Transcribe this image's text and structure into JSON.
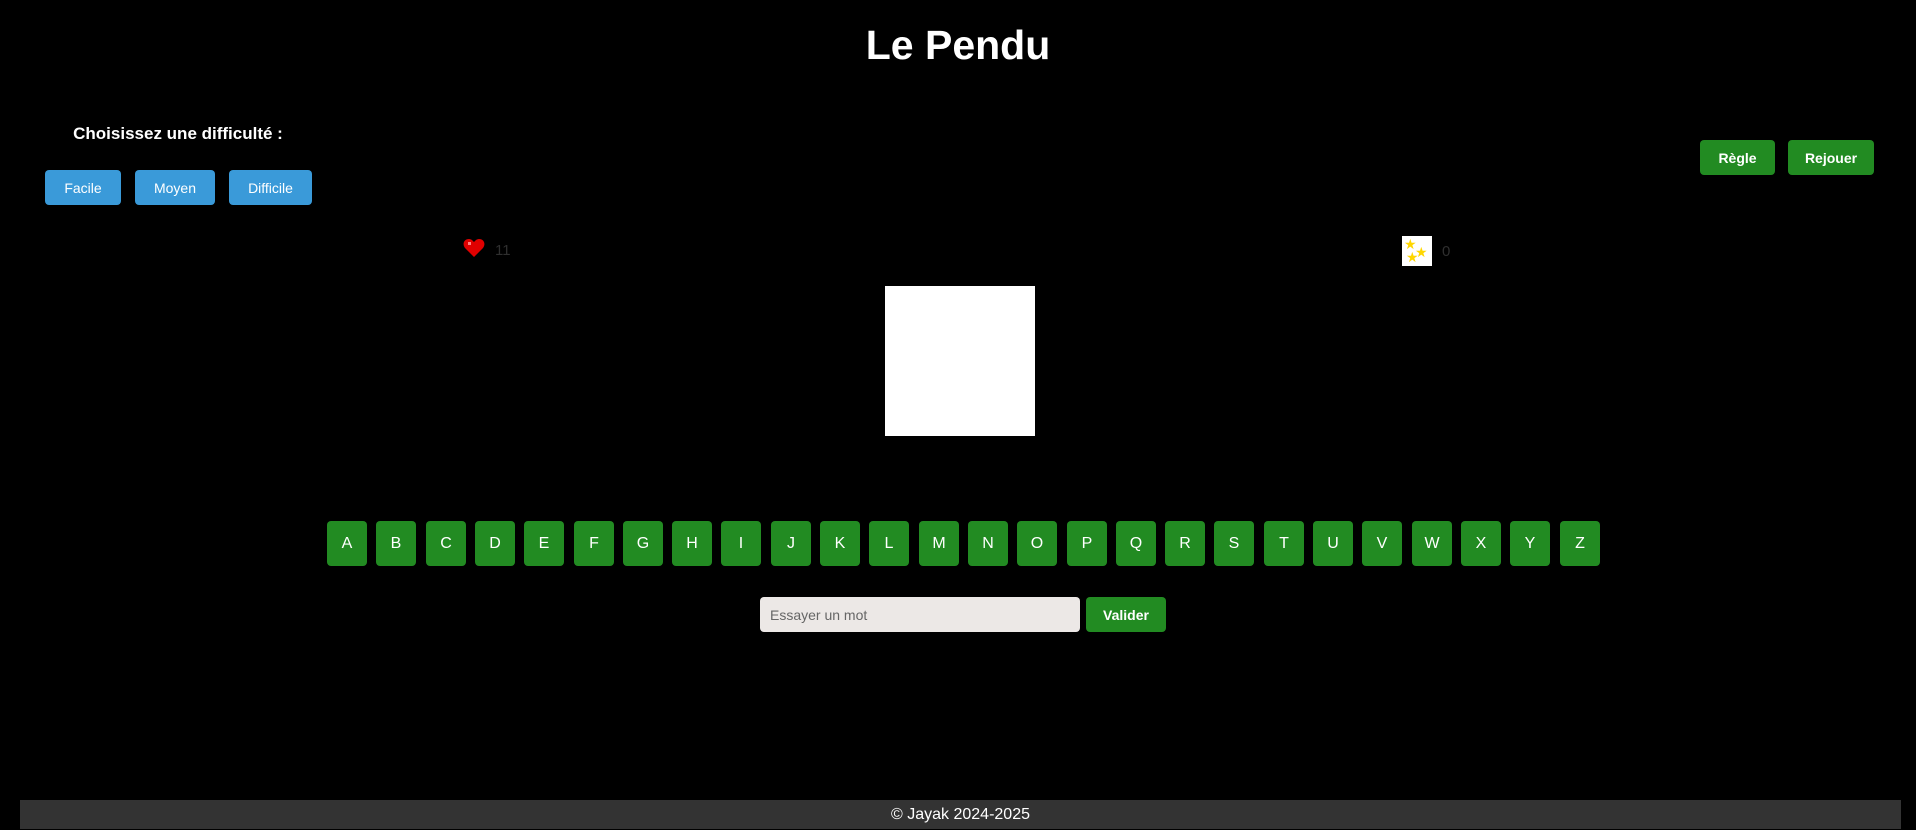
{
  "header": {
    "title": "Le Pendu"
  },
  "difficulty": {
    "label": "Choisissez une difficulté :",
    "options": [
      {
        "label": "Facile"
      },
      {
        "label": "Moyen"
      },
      {
        "label": "Difficile"
      }
    ],
    "color": "#3a9ad9"
  },
  "actions": {
    "rules_label": "Règle",
    "replay_label": "Rejouer"
  },
  "status": {
    "lives": "11",
    "lives_icon": "heart-icon",
    "score": "0",
    "score_icon": "stars-icon"
  },
  "keyboard": {
    "letters": [
      "A",
      "B",
      "C",
      "D",
      "E",
      "F",
      "G",
      "H",
      "I",
      "J",
      "K",
      "L",
      "M",
      "N",
      "O",
      "P",
      "Q",
      "R",
      "S",
      "T",
      "U",
      "V",
      "W",
      "X",
      "Y",
      "Z"
    ],
    "color": "#228b22"
  },
  "guess": {
    "placeholder": "Essayer un mot",
    "value": "",
    "submit_label": "Valider"
  },
  "footer": {
    "text": "© Jayak 2024-2025"
  }
}
